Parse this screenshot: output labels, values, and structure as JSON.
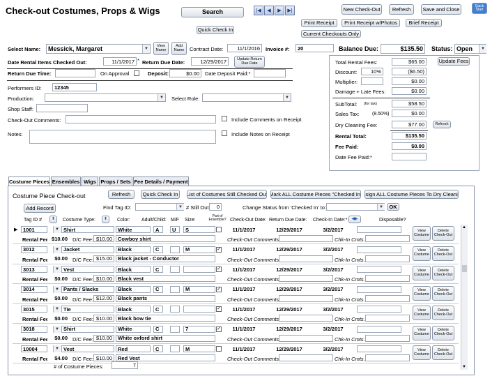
{
  "header": {
    "title": "Check-out Costumes, Props & Wigs",
    "search": "Search",
    "quick_check_in": "Quick Check In",
    "new_checkout": "New Check-Out",
    "refresh": "Refresh",
    "save_close": "Save and Close",
    "quick_start": "Quick Start",
    "print_receipt": "Print Receipt",
    "print_receipt_photos": "Print Receipt w/Photos",
    "brief_receipt": "Brief Receipt",
    "current_checkouts": "Current Checkouts Only"
  },
  "form": {
    "select_name_label": "Select Name:",
    "select_name_value": "Messick, Margaret",
    "view_name": "View Name",
    "add_name": "Add Name",
    "contract_date_label": "Contract Date:",
    "contract_date_value": "11/1/2016",
    "invoice_label": "Invoice #:",
    "invoice_value": "20",
    "balance_due_label": "Balance Due:",
    "balance_due_value": "$135.50",
    "status_label": "Status:",
    "status_value": "Open",
    "date_checked_out_label": "Date Rental Items Checked Out:",
    "date_checked_out_value": "11/1/2017",
    "return_due_label": "Return Due Date:",
    "return_due_value": "12/29/2017",
    "update_return": "Update Return Due Date",
    "return_due_time_label": "Return Due Time:",
    "on_approval_label": "On Approval",
    "deposit_label": "Deposit:",
    "deposit_value": "$0.00",
    "date_deposit_paid_label": "Date Deposit Paid:*",
    "performers_id_label": "Performers ID:",
    "performers_id_value": "12345",
    "production_label": "Production:",
    "select_role_label": "Select Role:",
    "shop_staff_label": "Shop Staff:",
    "checkout_comments_label": "Check-Out Comments:",
    "include_comments": "Include Comments on Receipt",
    "notes_label": "Notes:",
    "include_notes": "Include Notes on Receipt"
  },
  "fees": {
    "total_rental_label": "Total Rental Fees:",
    "total_rental_value": "$65.00",
    "update_fees": "Update Fees",
    "discount_label": "Discount:",
    "discount_pct": "10%",
    "discount_value": "($6.50)",
    "multiplier_label": "Multiplier:",
    "multiplier_value": "$0.00",
    "damage_label": "Damage + Late Fees:",
    "damage_value": "$0.00",
    "subtotal_label": "SubTotal:",
    "subtotal_tax": "(for tax)",
    "subtotal_value": "$58.50",
    "sales_tax_label": "Sales Tax:",
    "sales_tax_pct": "(8.50%)",
    "sales_tax_value": "$0.00",
    "dry_clean_label": "Dry Cleaning Fee:",
    "dry_clean_value": "$77.00",
    "refresh": "Refresh",
    "rental_total_label": "Rental Total:",
    "rental_total_value": "$135.50",
    "fee_paid_label": "Fee Paid:",
    "fee_paid_value": "$0.00",
    "date_fee_paid_label": "Date Fee Paid:*"
  },
  "tabs": [
    "Costume Pieces",
    "Ensembles",
    "Wigs",
    "Props / Sets",
    "Fee Details / Payment"
  ],
  "sub": {
    "title": "Costume Piece Check-out",
    "refresh": "Refresh",
    "quick_check_in": "Quick Check In",
    "list_still_out": "List of Costumes Still Checked Out",
    "mark_all": "Mark ALL Costume Pieces \"Checked In\"",
    "assign_dry": "Assign ALL Costume Pieces To Dry Cleaning",
    "add_record": "Add Record",
    "find_tag_label": "Find Tag ID:",
    "still_out_label": "# Still Out:",
    "still_out_value": "0",
    "change_status_label": "Change Status from 'Checked In'  to:",
    "ok": "OK"
  },
  "columns": {
    "tag": "Tag ID #",
    "type": "Costume Type:",
    "color": "Color:",
    "adult": "Adult/Child:",
    "mf": "M/F",
    "size": "Size:",
    "ensemble": "Part of Ensemble?",
    "checkout": "Check-Out Date:",
    "return": "Return Due Date:",
    "checkin": "Check-In Date:*",
    "disposable": "Disposable?"
  },
  "row_labels": {
    "rental_fee": "Rental Fee:",
    "dc_fee": "D/C Fee:",
    "co_comments": "Check-Out Comments:",
    "ci_comments": "Chk-In Cmts.",
    "view": "View Costume",
    "delete": "Delete Check-Out"
  },
  "rows": [
    {
      "tag": "1001",
      "type": "Shirt",
      "color": "White",
      "ac": "A",
      "mf": "U",
      "size": "S",
      "ens": false,
      "co": "11/1/2017",
      "ret": "12/29/2017",
      "ci": "3/2/2017",
      "fee": "$10.00",
      "dc": "$10.00",
      "desc": "Cowboy shirt"
    },
    {
      "tag": "3012",
      "type": "Jacket",
      "color": "Black",
      "ac": "C",
      "mf": "",
      "size": "M",
      "ens": true,
      "co": "11/1/2017",
      "ret": "12/29/2017",
      "ci": "3/2/2017",
      "fee": "$0.00",
      "dc": "$15.00",
      "desc": "Black jacket - Conductor"
    },
    {
      "tag": "3013",
      "type": "Vest",
      "color": "Black",
      "ac": "C",
      "mf": "",
      "size": "",
      "ens": true,
      "co": "11/1/2017",
      "ret": "12/29/2017",
      "ci": "3/2/2017",
      "fee": "$0.00",
      "dc": "$10.00",
      "desc": "Black vest"
    },
    {
      "tag": "3014",
      "type": "Pants / Slacks",
      "color": "Black",
      "ac": "C",
      "mf": "",
      "size": "M",
      "ens": true,
      "co": "11/1/2017",
      "ret": "12/29/2017",
      "ci": "3/2/2017",
      "fee": "$0.00",
      "dc": "$12.00",
      "desc": "Black pants"
    },
    {
      "tag": "3015",
      "type": "Tie",
      "color": "Black",
      "ac": "C",
      "mf": "",
      "size": "",
      "ens": true,
      "co": "11/1/2017",
      "ret": "12/29/2017",
      "ci": "3/2/2017",
      "fee": "$0.00",
      "dc": "$10.00",
      "desc": "Black bow tie"
    },
    {
      "tag": "3018",
      "type": "Shirt",
      "color": "White",
      "ac": "C",
      "mf": "",
      "size": "7",
      "ens": true,
      "co": "11/1/2017",
      "ret": "12/29/2017",
      "ci": "3/2/2017",
      "fee": "$0.00",
      "dc": "$10.00",
      "desc": "White oxford shirt"
    },
    {
      "tag": "10004",
      "type": "Vest",
      "color": "Red",
      "ac": "C",
      "mf": "",
      "size": "M",
      "ens": false,
      "co": "11/1/2017",
      "ret": "12/29/2017",
      "ci": "3/2/2017",
      "fee": "$4.00",
      "dc": "$10.00",
      "desc": "Red Vest"
    }
  ],
  "count_label": "# of Costume Pieces:",
  "count_value": "7"
}
